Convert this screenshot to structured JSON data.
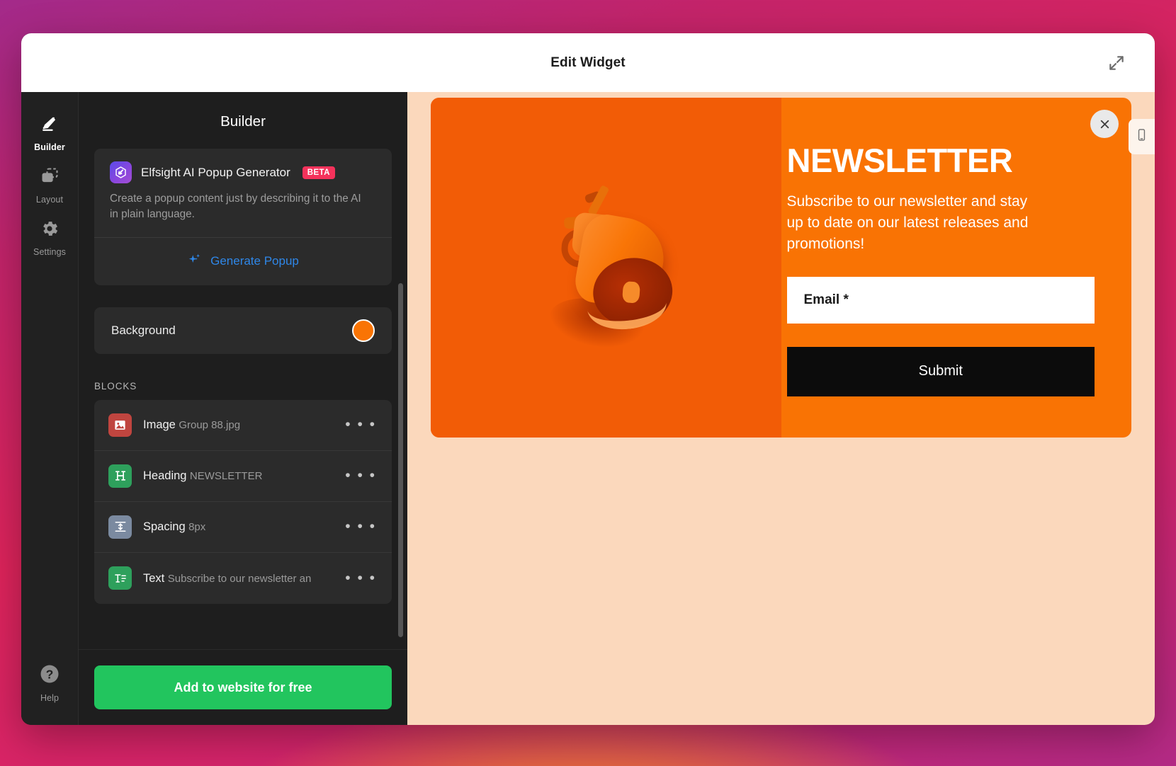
{
  "window": {
    "title": "Edit Widget",
    "expand_icon": "expand-diagonal-icon"
  },
  "rail": {
    "items": [
      {
        "label": "Builder",
        "icon": "pencil-icon",
        "active": true
      },
      {
        "label": "Layout",
        "icon": "layout-icon",
        "active": false
      },
      {
        "label": "Settings",
        "icon": "gear-icon",
        "active": false
      }
    ],
    "help": {
      "label": "Help",
      "icon": "question-circle-icon"
    }
  },
  "panel": {
    "title": "Builder",
    "ai_card": {
      "logo_icon": "elfsight-logo-icon",
      "title": "Elfsight AI Popup Generator",
      "badge": "BETA",
      "description": "Create a popup content just by describing it to the AI in plain language.",
      "generate_label": "Generate Popup",
      "generate_icon": "sparkles-icon"
    },
    "background": {
      "label": "Background",
      "color": "#f97404"
    },
    "blocks_title": "BLOCKS",
    "blocks": [
      {
        "name": "Image",
        "sub": "Group 88.jpg",
        "icon": "image-icon",
        "icon_color": "#c0453f",
        "more": "• • •"
      },
      {
        "name": "Heading",
        "sub": "NEWSLETTER",
        "icon": "heading-icon",
        "icon_color": "#2ea05c",
        "more": "• • •"
      },
      {
        "name": "Spacing",
        "sub": "8px",
        "icon": "spacing-icon",
        "icon_color": "#7b8aa0",
        "more": "• • •"
      },
      {
        "name": "Text",
        "sub": "Subscribe to our newsletter an",
        "icon": "text-icon",
        "icon_color": "#2ea05c",
        "more": "• • •"
      }
    ],
    "cta_label": "Add to website for free"
  },
  "preview": {
    "close_icon": "close-x-icon",
    "mobile_tab_icon": "mobile-phone-icon",
    "popup": {
      "background_color": "#f97304",
      "image_alt": "megaphone-photo",
      "heading": "NEWSLETTER",
      "text": "Subscribe to our newsletter and stay up to date on our latest releases and promotions!",
      "email_placeholder": "Email *",
      "email_value": "",
      "submit_label": "Submit"
    },
    "stage_background_color": "#fbd8bc"
  }
}
